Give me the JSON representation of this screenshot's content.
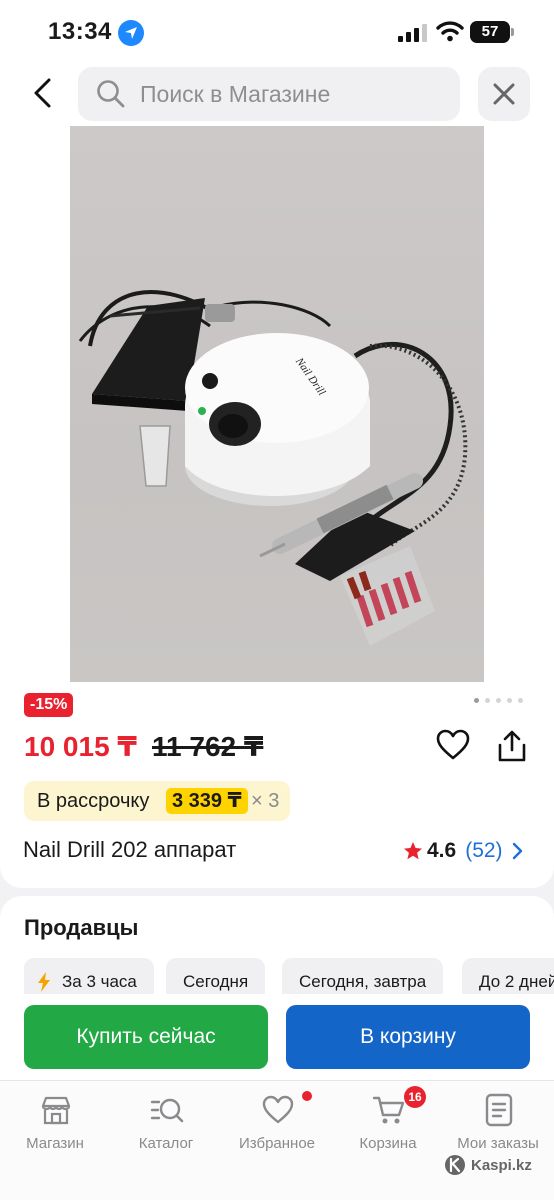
{
  "status_bar": {
    "time": "13:34",
    "battery": "57"
  },
  "search": {
    "placeholder": "Поиск в Магазине"
  },
  "product": {
    "discount": "-15%",
    "price": "10 015 ₸",
    "old_price": "11 762 ₸",
    "installment_label": "В рассрочку",
    "installment_amount": "3 339 ₸",
    "installment_multiplier": "× 3",
    "title": "Nail Drill 202 аппарат",
    "rating": "4.6",
    "reviews": "(52)",
    "image_count": 5,
    "active_image": 1,
    "photo_label": "Nail Drill"
  },
  "sellers": {
    "title": "Продавцы",
    "filters": [
      "За 3 часа",
      "Сегодня",
      "Сегодня, завтра",
      "До 2 дней"
    ]
  },
  "actions": {
    "buy_now": "Купить сейчас",
    "add_to_cart": "В корзину"
  },
  "tab_bar": {
    "items": [
      {
        "label": "Магазин",
        "icon": "shop-icon"
      },
      {
        "label": "Каталог",
        "icon": "catalog-search-icon"
      },
      {
        "label": "Избранное",
        "icon": "heart-icon"
      },
      {
        "label": "Корзина",
        "icon": "cart-icon"
      },
      {
        "label": "Мои заказы",
        "icon": "orders-icon"
      }
    ],
    "cart_count": "16"
  },
  "watermark": "Kaspi.kz",
  "colors": {
    "accent_red": "#e8222e",
    "buy_green": "#22a845",
    "cart_blue": "#1365c8",
    "installment_yellow": "#ffd300",
    "link_blue": "#1e6fd9"
  }
}
